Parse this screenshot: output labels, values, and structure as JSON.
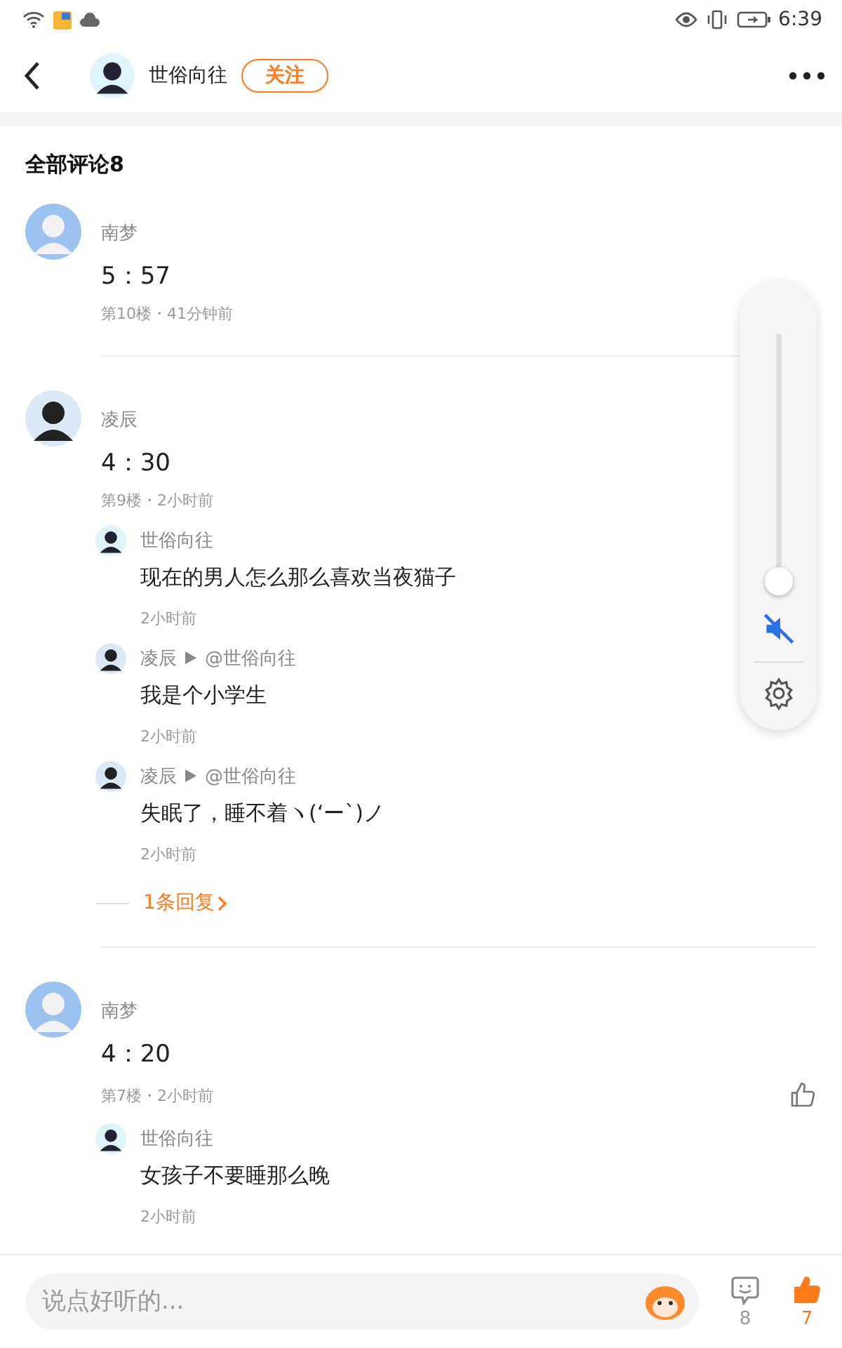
{
  "status_bar": {
    "time": "6:39"
  },
  "header": {
    "username": "世俗向往",
    "follow_label": "关注",
    "followed": false
  },
  "comments_title": "全部评论8",
  "comments": [
    {
      "author": "南梦",
      "text": "5：57",
      "meta": "第10楼・41分钟前"
    },
    {
      "author": "凌辰",
      "text": "4：30",
      "meta": "第9楼・2小时前",
      "replies": [
        {
          "author": "世俗向往",
          "text": "现在的男人怎么那么喜欢当夜猫子",
          "time": "2小时前"
        },
        {
          "author": "凌辰",
          "reply_to": "@世俗向往",
          "text": "我是个小学生",
          "time": "2小时前"
        },
        {
          "author": "凌辰",
          "reply_to": "@世俗向往",
          "text": "失眠了，睡不着ヽ(‘ー`)ノ",
          "time": "2小时前"
        }
      ],
      "more_replies": "1条回复"
    },
    {
      "author": "南梦",
      "text": "4：20",
      "meta": "第7楼・2小时前",
      "replies": [
        {
          "author": "世俗向往",
          "text": "女孩子不要睡那么晚",
          "time": "2小时前"
        }
      ]
    }
  ],
  "volume": {
    "level": 0.02,
    "muted": true
  },
  "bottom_bar": {
    "placeholder": "说点好听的...",
    "comment_count": "8",
    "like_count": "7",
    "liked": true
  }
}
